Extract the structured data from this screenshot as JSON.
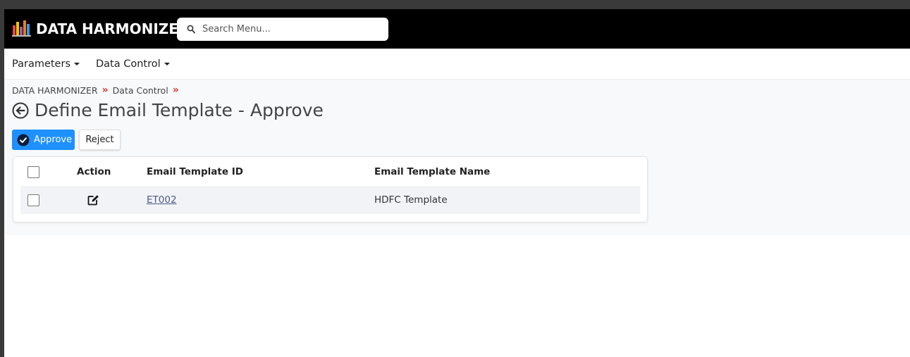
{
  "app": {
    "brand": "DATA HARMONIZER",
    "search_placeholder": "Search Menu..."
  },
  "menu": {
    "items": [
      {
        "label": "Parameters"
      },
      {
        "label": "Data Control"
      }
    ]
  },
  "breadcrumb": [
    "DATA HARMONIZER",
    "Data Control"
  ],
  "page": {
    "title": "Define Email Template - Approve"
  },
  "actions": {
    "approve_label": "Approve",
    "reject_label": "Reject"
  },
  "table": {
    "columns": [
      "Action",
      "Email Template ID",
      "Email Template Name"
    ],
    "rows": [
      {
        "id": "ET002",
        "name": "HDFC Template",
        "checked": false
      }
    ]
  },
  "colors": {
    "topbar": "#000000",
    "approve": "#1e90ff",
    "breadcrumb_separator": "#d9342b"
  },
  "icons": {
    "logo": "bar-chart-logo-icon",
    "search": "search-icon",
    "back": "back-arrow-icon",
    "approve": "check-circle-icon",
    "edit": "edit-icon"
  }
}
